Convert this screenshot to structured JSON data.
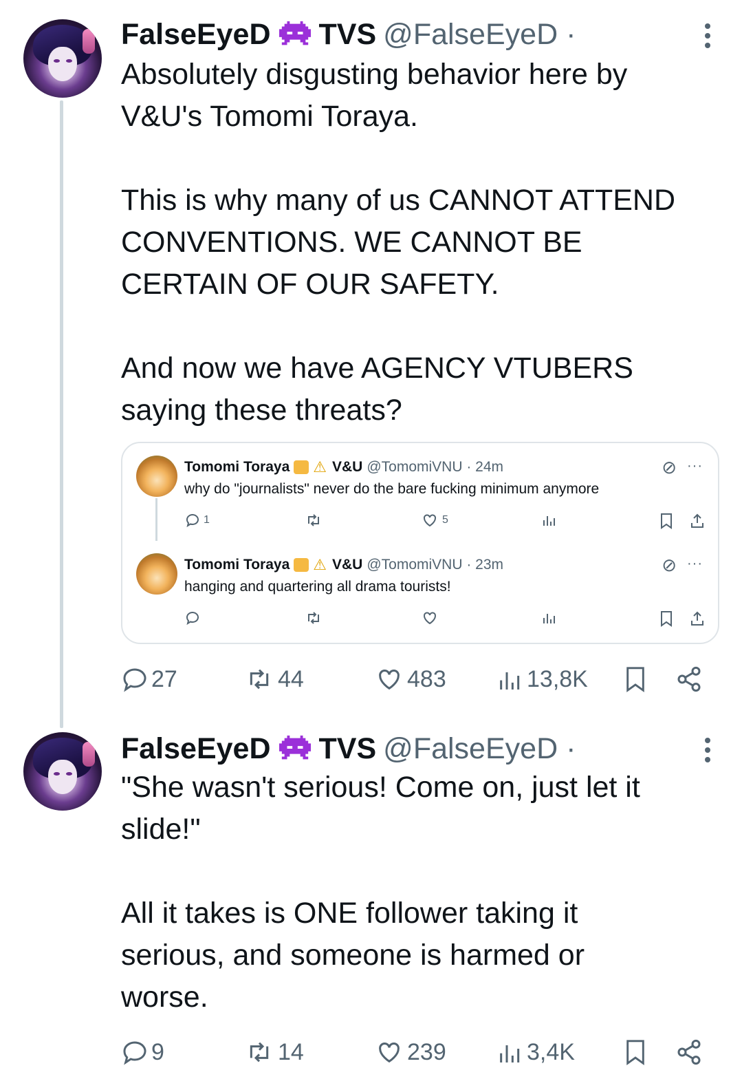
{
  "tweets": [
    {
      "author_name": "FalseEyeD",
      "affiliation": "TVS",
      "handle": "@FalseEyeD ·",
      "text": "Absolutely disgusting behavior here by\nV&U's Tomomi Toraya.\n\nThis is why many of us CANNOT ATTEND\nCONVENTIONS. WE CANNOT BE\nCERTAIN OF OUR SAFETY.\n\nAnd now we have AGENCY VTUBERS\nsaying these threats?",
      "stats": {
        "replies": "27",
        "reposts": "44",
        "likes": "483",
        "views": "13,8K"
      }
    },
    {
      "author_name": "FalseEyeD",
      "affiliation": "TVS",
      "handle": "@FalseEyeD ·",
      "text": "\"She wasn't serious! Come on, just let it\nslide!\"\n\nAll it takes is ONE follower taking it\nserious, and someone is harmed or\nworse.",
      "stats": {
        "replies": "9",
        "reposts": "14",
        "likes": "239",
        "views": "3,4K"
      }
    }
  ],
  "quote": {
    "posts": [
      {
        "author_name": "Tomomi Toraya",
        "affiliation": "V&U",
        "handle": "@TomomiVNU · 24m",
        "text": "why do \"journalists\" never do the bare fucking minimum anymore",
        "replies": "1",
        "likes": "5"
      },
      {
        "author_name": "Tomomi Toraya",
        "affiliation": "V&U",
        "handle": "@TomomiVNU · 23m",
        "text": "hanging and quartering all drama tourists!",
        "replies": "",
        "likes": ""
      }
    ],
    "more_label": "···"
  },
  "icons": [
    "reply-icon",
    "repost-icon",
    "like-icon",
    "views-icon",
    "bookmark-icon",
    "share-icon",
    "more-vertical-icon",
    "alien-emoji-icon",
    "tiger-emoji-icon",
    "warning-emoji-icon",
    "grok-icon"
  ],
  "colors": {
    "text": "#0f1419",
    "secondary": "#536471",
    "border": "#dfe4e8",
    "alien": "#9b30d9"
  }
}
